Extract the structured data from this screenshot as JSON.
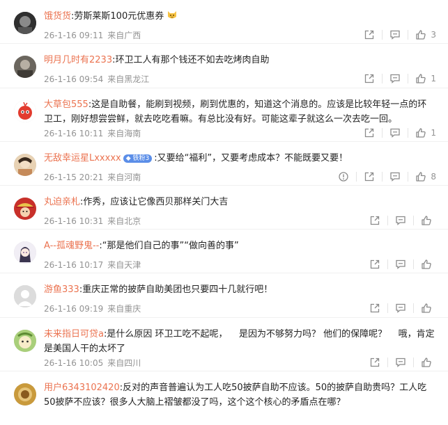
{
  "comments": [
    {
      "username": "饿货货",
      "tag": "",
      "text": ":劳斯莱斯100元优惠券",
      "has_emoji": true,
      "date": "26-1-16 09:11",
      "location": "来自广西",
      "likes": "3",
      "has_report": false,
      "avatar_color": "#333333"
    },
    {
      "username": "明月几时有2233",
      "tag": "",
      "text": ":环卫工人有那个钱还不如去吃烤肉自助",
      "has_emoji": false,
      "date": "26-1-16 09:54",
      "location": "来自黑龙江",
      "likes": "1",
      "has_report": false,
      "avatar_color": "#5e5a52"
    },
    {
      "username": "大草包555",
      "tag": "",
      "text": ":这是自助餐，能刷到视频，刷到优惠的，知道这个消息的。应该是比较年轻一点的环卫工，刚好想尝尝鲜，就去吃吃看嘛。有总比没有好。可能这辈子就这么一次去吃一回。",
      "has_emoji": false,
      "date": "26-1-16 10:11",
      "location": "来自海南",
      "likes": "1",
      "has_report": false,
      "avatar_color": "#e23b2e"
    },
    {
      "username": "无敌幸运星Lxxxxx",
      "tag": "铁粉3",
      "text": ":又要给“福利”，又要考虑成本？不能既要又要！",
      "has_emoji": false,
      "date": "26-1-15 20:21",
      "location": "来自河南",
      "likes": "8",
      "has_report": true,
      "avatar_color": "#d8b48a"
    },
    {
      "username": "丸迫亲札",
      "tag": "",
      "text": ":作秀，应该让它像西贝那样关门大吉",
      "has_emoji": false,
      "date": "26-1-16 10:31",
      "location": "来自北京",
      "likes": "",
      "has_report": false,
      "avatar_color": "#c8302a"
    },
    {
      "username": "A--孤魂野鬼--",
      "tag": "",
      "text": ":“那是他们自己的事”“做向善的事”",
      "has_emoji": false,
      "date": "26-1-16 10:17",
      "location": "来自天津",
      "likes": "",
      "has_report": false,
      "avatar_color": "#e9e6ef"
    },
    {
      "username": "游鱼333",
      "tag": "",
      "text": ":重庆正常的披萨自助美团也只要四十几就行吧！",
      "has_emoji": false,
      "date": "26-1-16 09:19",
      "location": "来自重庆",
      "likes": "",
      "has_report": false,
      "avatar_color": "#d7d7d7"
    },
    {
      "username": "未来指日可贷a",
      "tag": "",
      "text": ":是什么原因 环卫工吃不起呢，    是因为不够努力吗？ 他们的保障呢？    哦，肯定是美国人干的太坏了",
      "has_emoji": false,
      "date": "26-1-16 10:05",
      "location": "来自四川",
      "likes": "",
      "has_report": false,
      "avatar_color": "#8db95a"
    },
    {
      "username": "用户6343102420",
      "tag": "",
      "text": ":反对的声音普遍认为工人吃50披萨自助不应该。50的披萨自助贵吗？工人吃50披萨不应该？很多人大脑上褶皱都没了吗，这个这个核心的矛盾点在哪？",
      "has_emoji": false,
      "date": "",
      "location": "",
      "likes": "",
      "has_report": false,
      "avatar_color": "#c99a3c"
    }
  ]
}
